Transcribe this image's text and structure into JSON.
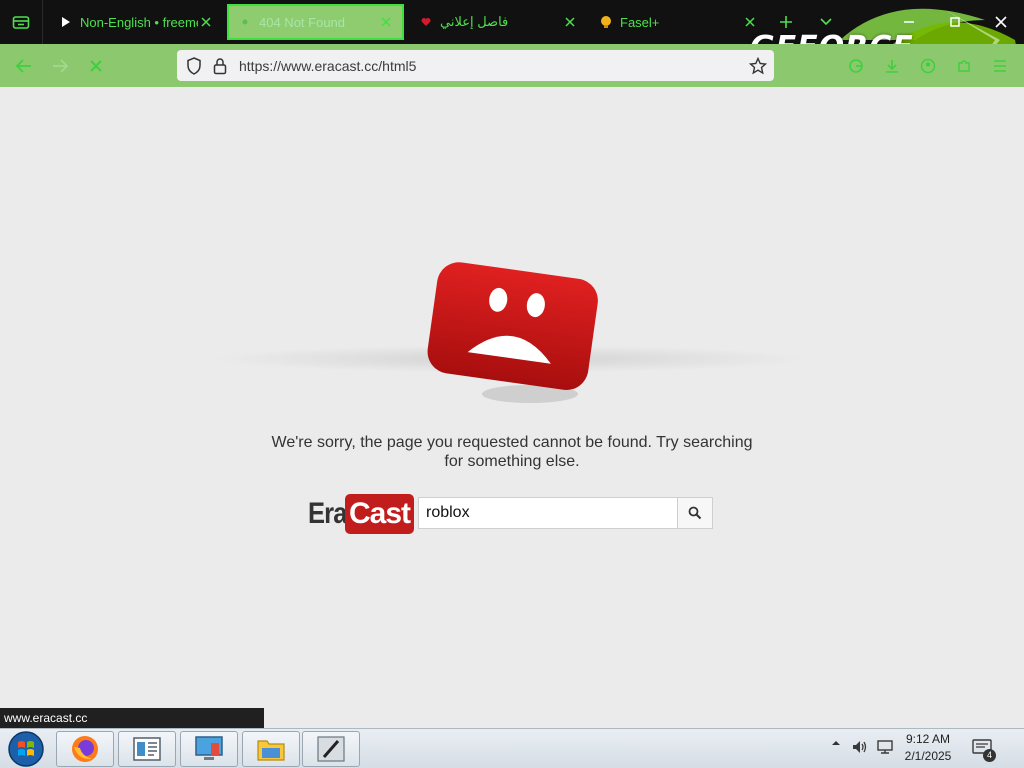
{
  "browser": {
    "tabs": [
      {
        "title": "Non-English • freemediaheckyeah",
        "icon": "play-icon"
      },
      {
        "title": "404 Not Found",
        "icon": "loading-dot-icon",
        "active": true
      },
      {
        "title": "فاصل إعلاني",
        "icon": "heart-icon"
      },
      {
        "title": "Fasel+",
        "icon": "bulb-icon"
      }
    ],
    "url": "https://www.eracast.cc/html5",
    "overlay_brand": "GEFORCE",
    "accent_color": "#8cc86e",
    "tab_text_color": "#4ee04e"
  },
  "page": {
    "error_message": "We're sorry, the page you requested cannot be found. Try searching for something else.",
    "logo_era": "Era",
    "logo_cast": "Cast",
    "search_value": "roblox",
    "brand_red": "#c21d1d"
  },
  "status_bar": {
    "hover_url": "www.eracast.cc"
  },
  "taskbar": {
    "apps": [
      "firefox-icon",
      "document-viewer-icon",
      "remote-desktop-icon",
      "file-explorer-icon",
      "drawing-app-icon"
    ],
    "time": "9:12 AM",
    "date": "2/1/2025",
    "notification_count": "4"
  }
}
